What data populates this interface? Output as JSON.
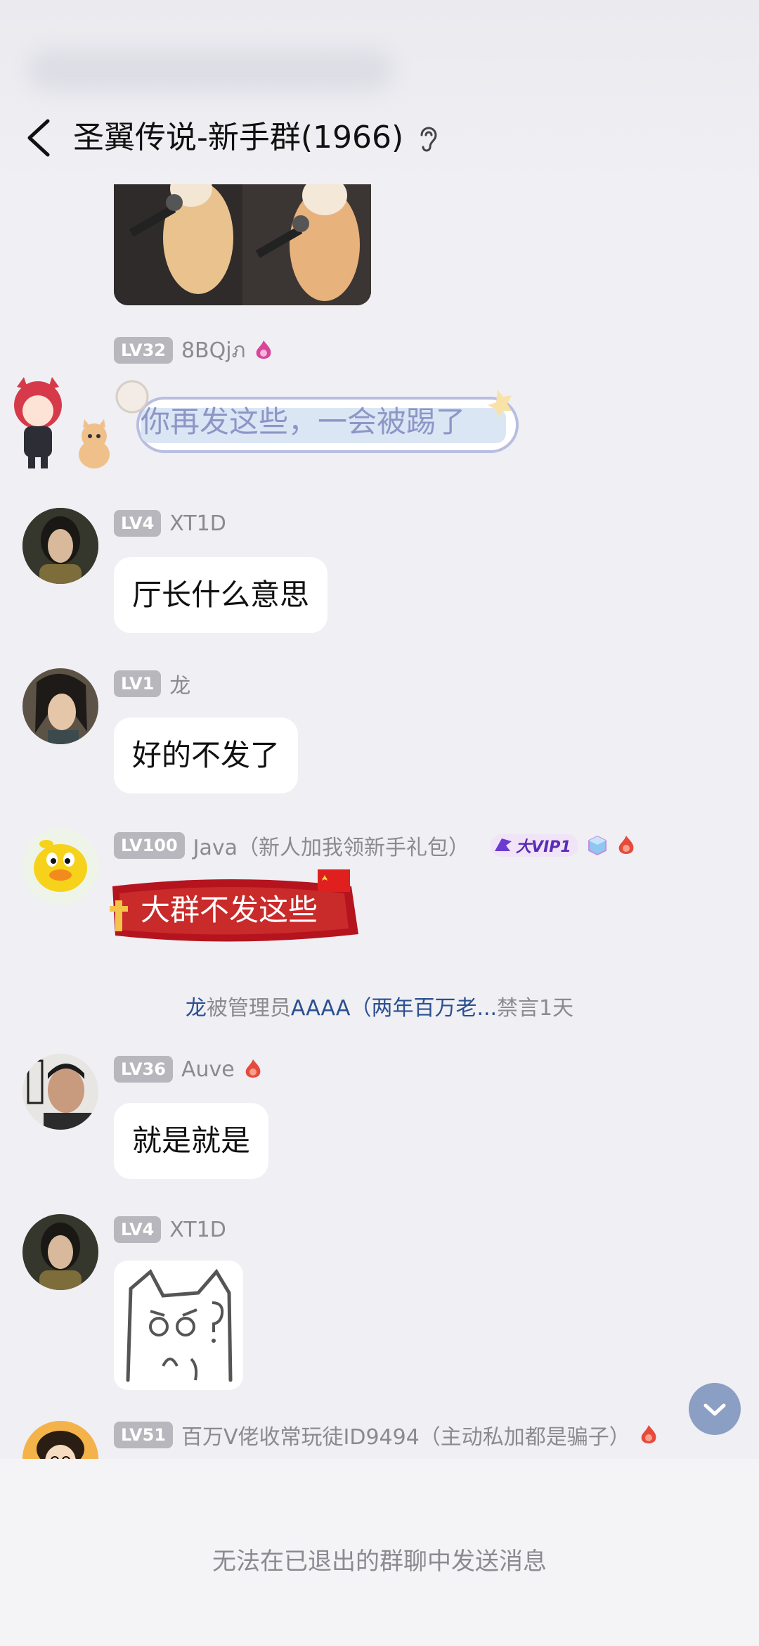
{
  "header": {
    "title": "圣翼传说-新手群(1966)"
  },
  "messages": [
    {
      "level": "LV32",
      "nickname": "8BQjภ",
      "text": "你再发这些，一会被踢了"
    },
    {
      "level": "LV4",
      "nickname": "XT1D",
      "text": "厅长什么意思"
    },
    {
      "level": "LV1",
      "nickname": "龙",
      "text": "好的不发了"
    },
    {
      "level": "LV100",
      "nickname": "Java（新人加我领新手礼包）",
      "vip_label": "大VIP1",
      "text": "大群不发这些"
    },
    {
      "level": "LV36",
      "nickname": "Auve",
      "text": "就是就是"
    },
    {
      "level": "LV4",
      "nickname": "XT1D"
    },
    {
      "level": "LV51",
      "nickname": "百万V佬收常玩徒ID9494（主动私加都是骗子）"
    }
  ],
  "system_notice": {
    "user": "龙",
    "action": "被管理员",
    "admin": "AAAA（两年百万老...",
    "result": "禁言1天"
  },
  "bottom_bar": {
    "text": "无法在已退出的群聊中发送消息"
  }
}
